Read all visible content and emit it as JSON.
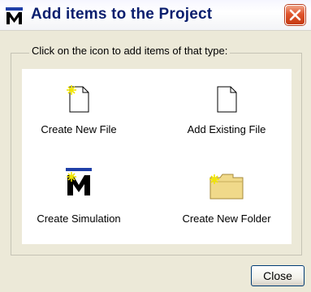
{
  "window": {
    "title": "Add items to the Project",
    "app_icon": "m-logo-icon",
    "close_icon": "close-icon"
  },
  "group": {
    "caption": "Click on the icon to add items of that type:"
  },
  "items": [
    {
      "label": "Create New File",
      "icon": "new-file-icon"
    },
    {
      "label": "Add Existing File",
      "icon": "existing-file-icon"
    },
    {
      "label": "Create Simulation",
      "icon": "simulation-icon"
    },
    {
      "label": "Create New Folder",
      "icon": "new-folder-icon"
    }
  ],
  "footer": {
    "close_label": "Close"
  },
  "colors": {
    "title_text": "#0a1e6e",
    "close_button_red": "#e0542c",
    "panel_bg": "#ffffff",
    "window_bg": "#ece9d8",
    "sparkle": "#f2e600",
    "folder": "#f0d98a"
  }
}
